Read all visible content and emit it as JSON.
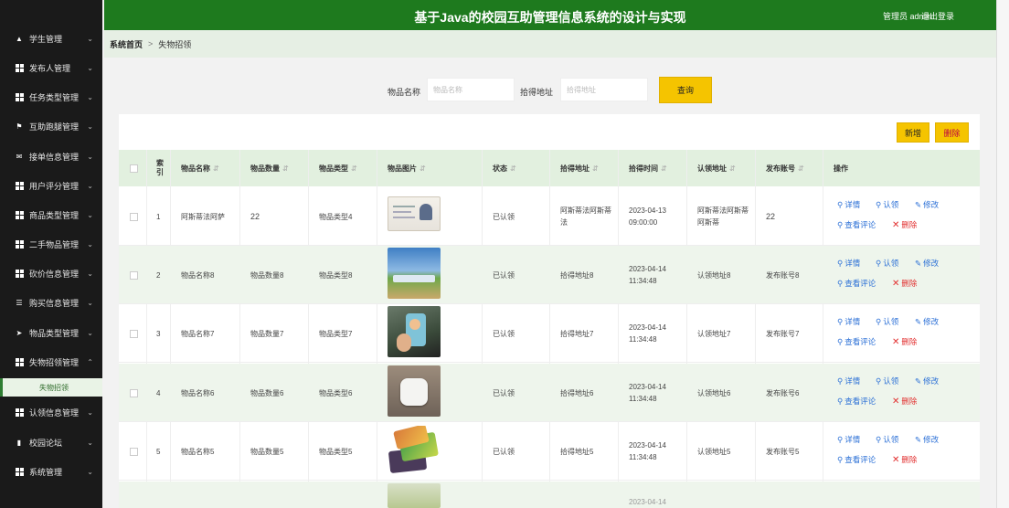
{
  "header": {
    "title": "基于Java的校园互助管理信息系统的设计与实现",
    "user": "管理员 admin",
    "logout": "退出登录"
  },
  "sidebar": {
    "items": [
      {
        "label": "学生管理",
        "icon": "user-icon"
      },
      {
        "label": "发布人管理",
        "icon": "grid-icon"
      },
      {
        "label": "任务类型管理",
        "icon": "grid-icon"
      },
      {
        "label": "互助跑腿管理",
        "icon": "flag-icon"
      },
      {
        "label": "接单信息管理",
        "icon": "envelope-icon"
      },
      {
        "label": "用户评分管理",
        "icon": "grid-icon"
      },
      {
        "label": "商品类型管理",
        "icon": "grid-icon"
      },
      {
        "label": "二手物品管理",
        "icon": "grid-icon"
      },
      {
        "label": "砍价信息管理",
        "icon": "grid-icon"
      },
      {
        "label": "购买信息管理",
        "icon": "list-icon"
      },
      {
        "label": "物品类型管理",
        "icon": "send-icon"
      },
      {
        "label": "失物招领管理",
        "icon": "grid-icon"
      },
      {
        "label": "认领信息管理",
        "icon": "grid-icon"
      },
      {
        "label": "校园论坛",
        "icon": "chat-icon"
      },
      {
        "label": "系统管理",
        "icon": "grid-icon"
      }
    ],
    "sub_item": "失物招领"
  },
  "breadcrumb": {
    "home": "系统首页",
    "sep": ">",
    "current": "失物招领"
  },
  "search": {
    "name_label": "物品名称",
    "name_placeholder": "物品名称",
    "addr_label": "拾得地址",
    "addr_placeholder": "拾得地址",
    "button": "查询"
  },
  "toolbar": {
    "add": "新增",
    "delete": "删除"
  },
  "table": {
    "columns": [
      "索引",
      "物品名称",
      "物品数量",
      "物品类型",
      "物品图片",
      "状态",
      "拾得地址",
      "拾得时间",
      "认领地址",
      "发布账号",
      "操作"
    ],
    "index_header": [
      "索",
      "引"
    ],
    "rows": [
      {
        "idx": "1",
        "name": "阿斯蒂法阿萨",
        "qty": "22",
        "type": "物品类型4",
        "status": "已认领",
        "addr": "阿斯蒂法阿斯蒂法",
        "date": "2023-04-13",
        "time": "09:00:00",
        "claim": "阿斯蒂法阿斯蒂阿斯蒂",
        "acct": "22"
      },
      {
        "idx": "2",
        "name": "物品名称8",
        "qty": "物品数量8",
        "type": "物品类型8",
        "status": "已认领",
        "addr": "拾得地址8",
        "date": "2023-04-14",
        "time": "11:34:48",
        "claim": "认领地址8",
        "acct": "发布账号8"
      },
      {
        "idx": "3",
        "name": "物品名称7",
        "qty": "物品数量7",
        "type": "物品类型7",
        "status": "已认领",
        "addr": "拾得地址7",
        "date": "2023-04-14",
        "time": "11:34:48",
        "claim": "认领地址7",
        "acct": "发布账号7"
      },
      {
        "idx": "4",
        "name": "物品名称6",
        "qty": "物品数量6",
        "type": "物品类型6",
        "status": "已认领",
        "addr": "拾得地址6",
        "date": "2023-04-14",
        "time": "11:34:48",
        "claim": "认领地址6",
        "acct": "发布账号6"
      },
      {
        "idx": "5",
        "name": "物品名称5",
        "qty": "物品数量5",
        "type": "物品类型5",
        "status": "已认领",
        "addr": "拾得地址5",
        "date": "2023-04-14",
        "time": "11:34:48",
        "claim": "认领地址5",
        "acct": "发布账号5"
      }
    ],
    "partial_row_date": "2023-04-14",
    "actions": {
      "detail": "详情",
      "claim": "认领",
      "edit": "修改",
      "comments": "查看评论",
      "delete": "删除"
    }
  }
}
